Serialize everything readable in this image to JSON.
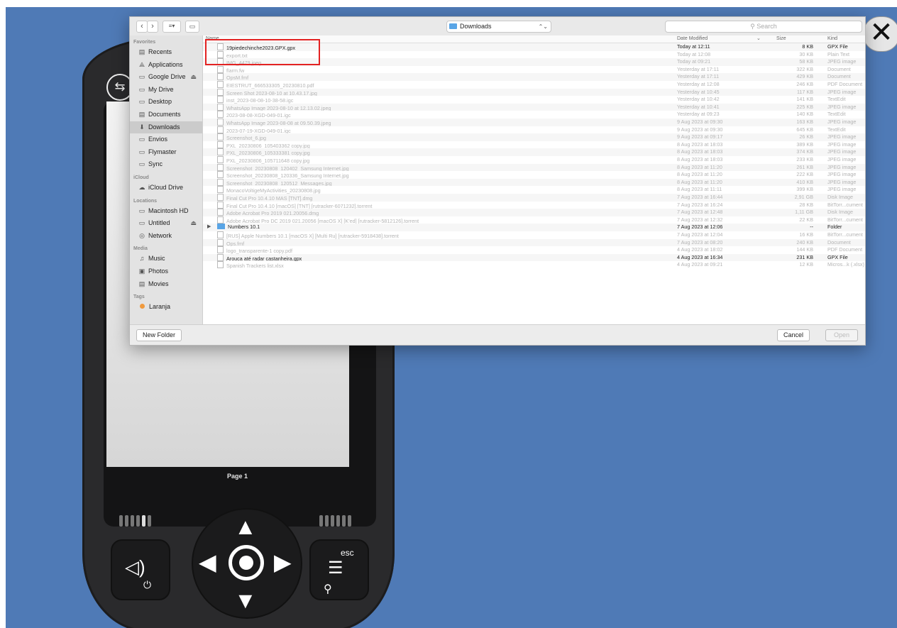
{
  "device": {
    "page_label": "Page 1",
    "esc_label": "esc",
    "usb_icon": "usb-icon",
    "close_glyph": "✕"
  },
  "dialog": {
    "location": "Downloads",
    "search_placeholder": "Search",
    "columns": {
      "name": "Name",
      "date": "Date Modified",
      "size": "Size",
      "kind": "Kind"
    },
    "new_folder": "New Folder",
    "cancel": "Cancel",
    "open": "Open"
  },
  "sidebar": {
    "favorites_head": "Favorites",
    "favorites": [
      {
        "label": "Recents",
        "icon": "▤"
      },
      {
        "label": "Applications",
        "icon": "⟁"
      },
      {
        "label": "Google Drive",
        "icon": "▭",
        "eject": "⏏"
      },
      {
        "label": "My Drive",
        "icon": "▭"
      },
      {
        "label": "Desktop",
        "icon": "▭"
      },
      {
        "label": "Documents",
        "icon": "▤"
      },
      {
        "label": "Downloads",
        "icon": "⬇"
      },
      {
        "label": "Envios",
        "icon": "▭"
      },
      {
        "label": "Flymaster",
        "icon": "▭"
      },
      {
        "label": "Sync",
        "icon": "▭"
      }
    ],
    "icloud_head": "iCloud",
    "icloud": [
      {
        "label": "iCloud Drive",
        "icon": "☁"
      }
    ],
    "locations_head": "Locations",
    "locations": [
      {
        "label": "Macintosh HD",
        "icon": "▭"
      },
      {
        "label": "Untitled",
        "icon": "▭",
        "eject": "⏏"
      },
      {
        "label": "Network",
        "icon": "◎"
      }
    ],
    "media_head": "Media",
    "media": [
      {
        "label": "Music",
        "icon": "♫"
      },
      {
        "label": "Photos",
        "icon": "▣"
      },
      {
        "label": "Movies",
        "icon": "▤"
      }
    ],
    "tags_head": "Tags",
    "tags": [
      {
        "label": "Laranja",
        "color": "#f09a3e"
      }
    ]
  },
  "files": [
    {
      "name": "19piedechinche2023.GPX.gpx",
      "date": "Today at 12:11",
      "size": "8 KB",
      "kind": "GPX File",
      "active": true
    },
    {
      "name": "export.txt",
      "date": "Today at 12:08",
      "size": "30 KB",
      "kind": "Plain Text"
    },
    {
      "name": "IMG_4479.jpeg",
      "date": "Today at 09:21",
      "size": "58 KB",
      "kind": "JPEG image"
    },
    {
      "name": "flarm.fw",
      "date": "Yesterday at 17:11",
      "size": "322 KB",
      "kind": "Document"
    },
    {
      "name": "OpsM.fmf",
      "date": "Yesterday at 17:11",
      "size": "429 KB",
      "kind": "Document"
    },
    {
      "name": "EIESTRUT_666533305_20230810.pdf",
      "date": "Yesterday at 12:08",
      "size": "246 KB",
      "kind": "PDF Document"
    },
    {
      "name": "Screen Shot 2023-08-10 at 10.43.17.jpg",
      "date": "Yesterday at 10:45",
      "size": "117 KB",
      "kind": "JPEG image"
    },
    {
      "name": "inst_2023-08-08-10-38-58.igc",
      "date": "Yesterday at 10:42",
      "size": "141 KB",
      "kind": "TextEdit"
    },
    {
      "name": "WhatsApp Image 2023-08-10 at 12.13.02.jpeg",
      "date": "Yesterday at 10:41",
      "size": "225 KB",
      "kind": "JPEG image"
    },
    {
      "name": "2023-08-08-XGD-049-01.igc",
      "date": "Yesterday at 09:23",
      "size": "140 KB",
      "kind": "TextEdit"
    },
    {
      "name": "WhatsApp Image 2023-08-08 at 09.50.39.jpeg",
      "date": "9 Aug 2023 at 09:30",
      "size": "163 KB",
      "kind": "JPEG image"
    },
    {
      "name": "2023-07-19-XGD-049-01.igc",
      "date": "9 Aug 2023 at 09:30",
      "size": "645 KB",
      "kind": "TextEdit"
    },
    {
      "name": "Screenshot_6.jpg",
      "date": "9 Aug 2023 at 09:17",
      "size": "26 KB",
      "kind": "JPEG image"
    },
    {
      "name": "PXL_20230806_105403362 copy.jpg",
      "date": "8 Aug 2023 at 18:03",
      "size": "389 KB",
      "kind": "JPEG image"
    },
    {
      "name": "PXL_20230806_105333381 copy.jpg",
      "date": "8 Aug 2023 at 18:03",
      "size": "374 KB",
      "kind": "JPEG image"
    },
    {
      "name": "PXL_20230806_105711648 copy.jpg",
      "date": "8 Aug 2023 at 18:03",
      "size": "233 KB",
      "kind": "JPEG image"
    },
    {
      "name": "Screenshot_20230808_120402_Samsung Internet.jpg",
      "date": "8 Aug 2023 at 11:20",
      "size": "261 KB",
      "kind": "JPEG image"
    },
    {
      "name": "Screenshot_20230808_120336_Samsung Internet.jpg",
      "date": "8 Aug 2023 at 11:20",
      "size": "222 KB",
      "kind": "JPEG image"
    },
    {
      "name": "Screenshot_20230808_120512_Messages.jpg",
      "date": "8 Aug 2023 at 11:20",
      "size": "410 KB",
      "kind": "JPEG image"
    },
    {
      "name": "MonacoVoltigeMyActivities_20230808.jpg",
      "date": "8 Aug 2023 at 11:11",
      "size": "399 KB",
      "kind": "JPEG image"
    },
    {
      "name": "Final Cut Pro 10.4.10 MAS [TNT].dmg",
      "date": "7 Aug 2023 at 16:44",
      "size": "2,91 GB",
      "kind": "Disk Image"
    },
    {
      "name": "Final Cut Pro 10.4.10 [macOS] [TNT] [rutracker-6071232].torrent",
      "date": "7 Aug 2023 at 16:24",
      "size": "28 KB",
      "kind": "BitTorr...cument"
    },
    {
      "name": "Adobe Acrobat Pro 2019 021.20056.dmg",
      "date": "7 Aug 2023 at 12:48",
      "size": "1,11 GB",
      "kind": "Disk Image"
    },
    {
      "name": "Adobe Acrobat Pro DC 2019 021.20056 [macOS X] [K'ed] [rutracker-5812126].torrent",
      "date": "7 Aug 2023 at 12:32",
      "size": "22 KB",
      "kind": "BitTorr...cument"
    },
    {
      "name": "Numbers 10.1",
      "date": "7 Aug 2023 at 12:06",
      "size": "--",
      "kind": "Folder",
      "active": true,
      "folder": true
    },
    {
      "name": "[RUS] Apple Numbers 10.1 [macOS X] [Multi Ru] [rutracker-5918438].torrent",
      "date": "7 Aug 2023 at 12:04",
      "size": "16 KB",
      "kind": "BitTorr...cument"
    },
    {
      "name": "Ops.fmf",
      "date": "7 Aug 2023 at 08:20",
      "size": "240 KB",
      "kind": "Document"
    },
    {
      "name": "logo_transparente-1 copy.pdf",
      "date": "4 Aug 2023 at 18:02",
      "size": "144 KB",
      "kind": "PDF Document"
    },
    {
      "name": "Arouca até radar castanheira.gpx",
      "date": "4 Aug 2023 at 16:34",
      "size": "231 KB",
      "kind": "GPX File",
      "active": true
    },
    {
      "name": "Spanish Trackers list.xlsx",
      "date": "4 Aug 2023 at 09:21",
      "size": "12 KB",
      "kind": "Micros...k (.xlsx)"
    }
  ]
}
